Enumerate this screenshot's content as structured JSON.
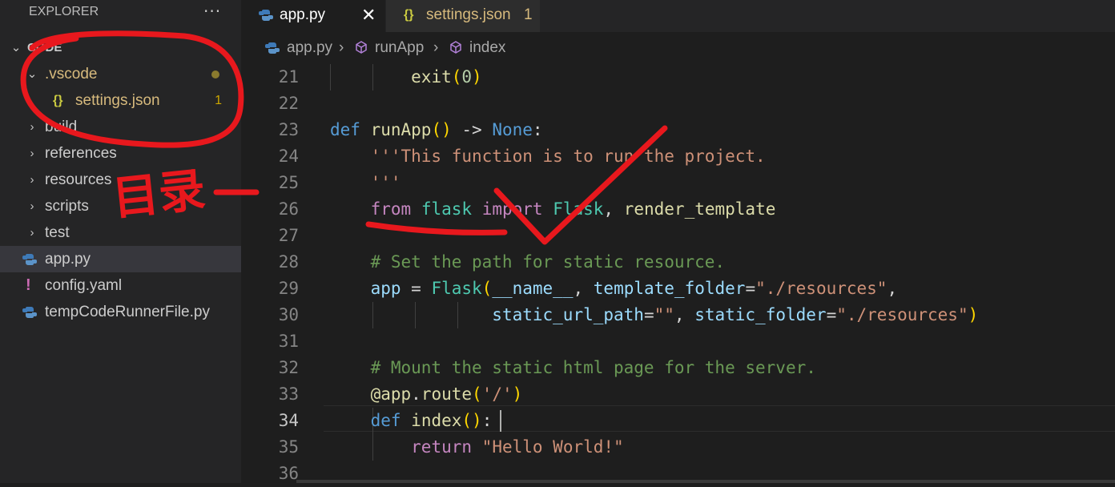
{
  "explorer": {
    "header": "EXPLORER",
    "more": "···",
    "root": "CODE",
    "items": [
      {
        "label": ".vscode",
        "type": "folder-open"
      },
      {
        "label": "settings.json",
        "type": "json",
        "badge": "1"
      },
      {
        "label": "build",
        "type": "folder"
      },
      {
        "label": "references",
        "type": "folder"
      },
      {
        "label": "resources",
        "type": "folder"
      },
      {
        "label": "scripts",
        "type": "folder"
      },
      {
        "label": "test",
        "type": "folder"
      },
      {
        "label": "app.py",
        "type": "python"
      },
      {
        "label": "config.yaml",
        "type": "yaml"
      },
      {
        "label": "tempCodeRunnerFile.py",
        "type": "python"
      }
    ]
  },
  "tabs": [
    {
      "label": "app.py",
      "active": true,
      "close": "✕"
    },
    {
      "label": "settings.json",
      "active": false,
      "badge": "1"
    }
  ],
  "breadcrumb": [
    "app.py",
    "runApp",
    "index"
  ],
  "editor": {
    "line_numbers": [
      "21",
      "22",
      "23",
      "24",
      "25",
      "26",
      "27",
      "28",
      "29",
      "30",
      "31",
      "32",
      "33",
      "34",
      "35",
      "36"
    ],
    "current_line": "34",
    "lines": [
      "        exit(0)",
      "",
      "def runApp() -> None:",
      "    '''This function is to run the project.",
      "    '''",
      "    from flask import Flask, render_template",
      "",
      "    # Set the path for static resource.",
      "    app = Flask(__name__, template_folder=\"./resources\",",
      "                static_url_path=\"\", static_folder=\"./resources\")",
      "",
      "    # Mount the static html page for the server.",
      "    @app.route('/')",
      "    def index():",
      "        return \"Hello World!\"",
      ""
    ]
  },
  "annotation": {
    "handwritten_text": "目录",
    "color": "#e8181d"
  },
  "colors": {
    "sidebar_bg": "#252526",
    "editor_bg": "#1e1e1e",
    "modified": "#d7ba7d",
    "keyword": "#569cd6",
    "string": "#ce9178",
    "comment": "#6a9955"
  }
}
